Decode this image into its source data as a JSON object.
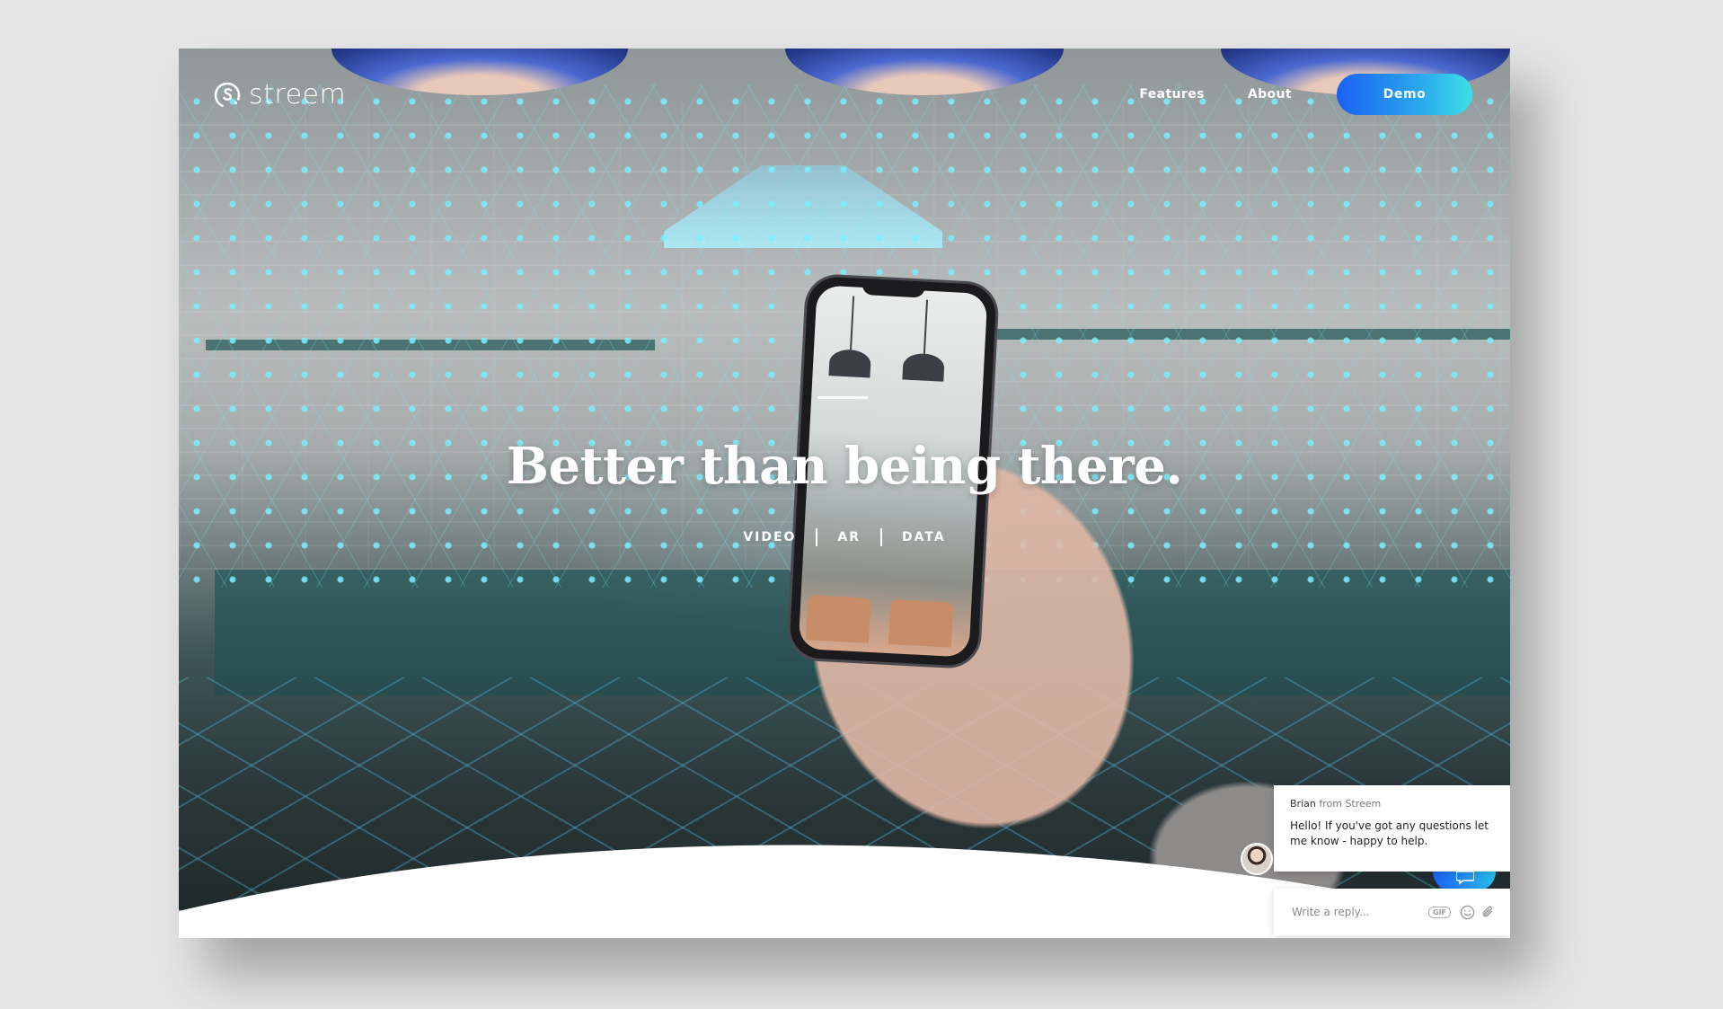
{
  "header": {
    "logo_text": "streem",
    "nav": {
      "features_label": "Features",
      "about_label": "About",
      "demo_label": "Demo"
    }
  },
  "hero": {
    "title": "Better than being there.",
    "tags": [
      "VIDEO",
      "AR",
      "DATA"
    ]
  },
  "chat": {
    "sender_name": "Brian",
    "sender_org": "from Streem",
    "message": "Hello! If you've got any questions let me know - happy to help.",
    "reply_placeholder": "Write a reply...",
    "gif_label": "GIF"
  },
  "colors": {
    "demo_gradient_start": "#1a62f5",
    "demo_gradient_end": "#3ce0e6",
    "page_background": "#e4e4e4"
  },
  "icons": {
    "logo": "streem-logo-icon",
    "gif": "gif-icon",
    "emoji": "emoji-icon",
    "attach": "paperclip-icon",
    "launcher": "chat-bubble-icon"
  }
}
